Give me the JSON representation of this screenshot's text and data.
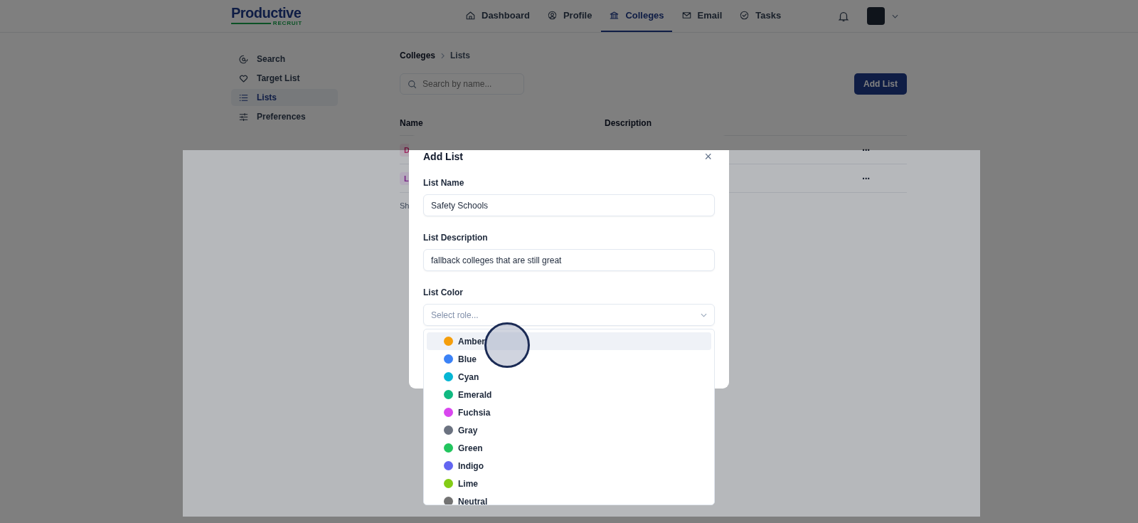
{
  "logo": {
    "name": "Productive",
    "tagline": "RECRUIT"
  },
  "nav": [
    {
      "label": "Dashboard",
      "selected": false
    },
    {
      "label": "Profile",
      "selected": false
    },
    {
      "label": "Colleges",
      "selected": true
    },
    {
      "label": "Email",
      "selected": false
    },
    {
      "label": "Tasks",
      "selected": false
    }
  ],
  "sidebar": {
    "items": [
      {
        "label": "Search",
        "selected": false
      },
      {
        "label": "Target List",
        "selected": false
      },
      {
        "label": "Lists",
        "selected": true
      },
      {
        "label": "Preferences",
        "selected": false
      }
    ]
  },
  "breadcrumb": [
    "Colleges",
    "Lists"
  ],
  "search": {
    "placeholder": "Search by name..."
  },
  "add_button": "Add List",
  "table": {
    "columns": [
      "Name",
      "Description"
    ],
    "rows": [
      {
        "badge": "D",
        "actions": "···"
      },
      {
        "badge": "L",
        "actions": "···"
      }
    ],
    "footer": "Sh"
  },
  "modal": {
    "title": "Add List",
    "close": "×",
    "fields": [
      {
        "label": "List Name",
        "kind": "input",
        "value": "Safety Schools"
      },
      {
        "label": "List Description",
        "kind": "input",
        "value": "fallback colleges that are still great"
      },
      {
        "label": "List Color",
        "kind": "select",
        "placeholder": "Select role..."
      }
    ],
    "options": [
      {
        "label": "Amber",
        "color": "#f59e0b",
        "highlighted": true
      },
      {
        "label": "Blue",
        "color": "#3b82f6",
        "highlighted": false
      },
      {
        "label": "Cyan",
        "color": "#06b6d4",
        "highlighted": false
      },
      {
        "label": "Emerald",
        "color": "#10b981",
        "highlighted": false
      },
      {
        "label": "Fuchsia",
        "color": "#d946ef",
        "highlighted": false
      },
      {
        "label": "Gray",
        "color": "#6b7280",
        "highlighted": false
      },
      {
        "label": "Green",
        "color": "#22c55e",
        "highlighted": false
      },
      {
        "label": "Indigo",
        "color": "#6366f1",
        "highlighted": false
      },
      {
        "label": "Lime",
        "color": "#84cc16",
        "highlighted": false
      },
      {
        "label": "Neutral",
        "color": "#737373",
        "highlighted": false
      }
    ]
  }
}
